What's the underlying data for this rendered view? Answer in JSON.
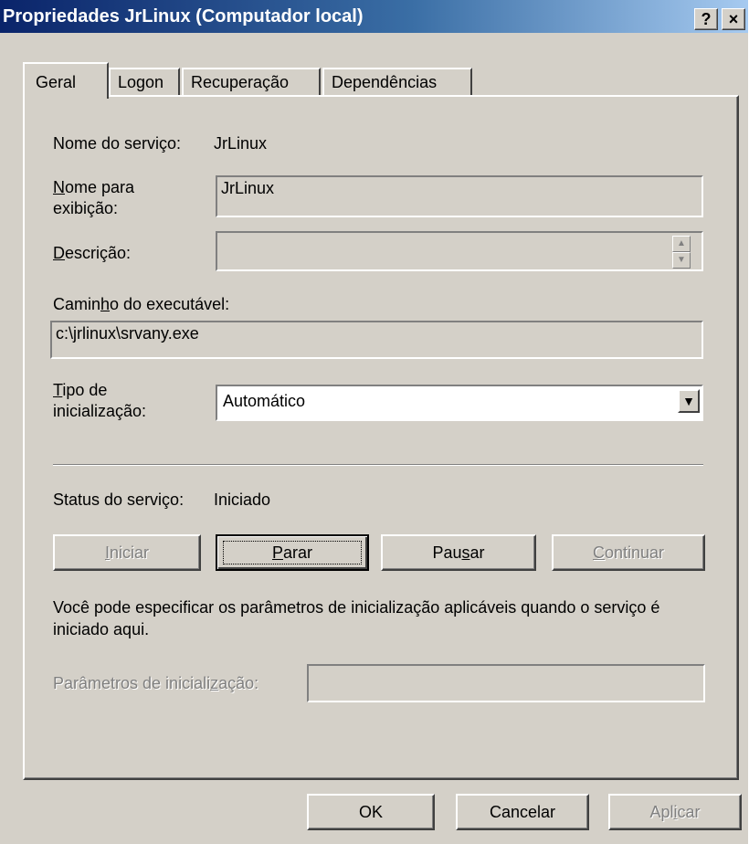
{
  "window": {
    "title": "Propriedades JrLinux (Computador local)",
    "help_label": "?",
    "close_label": "×"
  },
  "tabs": [
    {
      "label": "Geral",
      "active": true
    },
    {
      "label": "Logon",
      "active": false
    },
    {
      "label": "Recuperação",
      "active": false
    },
    {
      "label": "Dependências",
      "active": false
    }
  ],
  "general": {
    "service_name_label": "Nome do serviço:",
    "service_name_value": "JrLinux",
    "display_name_label_pre": "",
    "display_name_label_ul": "N",
    "display_name_label_line1_rest": "ome para",
    "display_name_label_line2": "exibição:",
    "display_name_value": "JrLinux",
    "description_label_ul": "D",
    "description_label_rest": "escrição:",
    "description_value": "",
    "exe_path_label_pre": "Camin",
    "exe_path_label_ul": "h",
    "exe_path_label_post": "o do executável:",
    "exe_path_value": "c:\\jrlinux\\srvany.exe",
    "startup_type_label_ul": "T",
    "startup_type_label_line1_rest": "ipo de",
    "startup_type_label_line2": "inicialização:",
    "startup_type_value": "Automático",
    "status_label": "Status do serviço:",
    "status_value": "Iniciado"
  },
  "service_buttons": {
    "start": {
      "ul": "I",
      "rest": "niciar",
      "enabled": false
    },
    "stop": {
      "ul": "P",
      "rest": "arar",
      "enabled": true
    },
    "pause_pre": "Pau",
    "pause_ul": "s",
    "pause_post": "ar",
    "continue": {
      "ul": "C",
      "rest": "ontinuar",
      "enabled": false
    }
  },
  "params": {
    "help_text": "Você pode especificar os parâmetros de inicialização aplicáveis quando o serviço é iniciado aqui.",
    "label_pre": "Parâmetros de iniciali",
    "label_ul": "z",
    "label_post": "ação:",
    "value": ""
  },
  "footer": {
    "ok_label": "OK",
    "cancel_label": "Cancelar",
    "apply_pre": "Apl",
    "apply_ul": "i",
    "apply_post": "car"
  },
  "colors": {
    "face": "#d4d0c8",
    "titlebar_start": "#0a246a",
    "titlebar_end": "#a6caf0",
    "disabled_text": "#808080"
  }
}
